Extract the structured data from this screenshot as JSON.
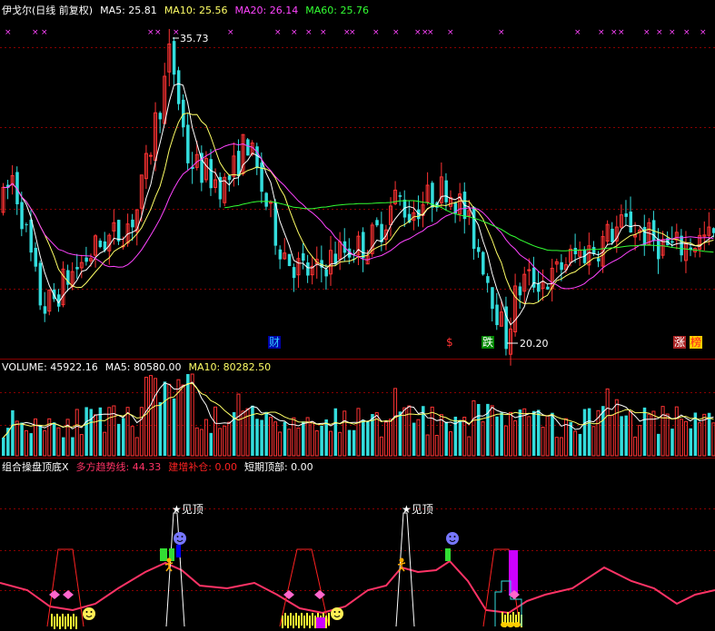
{
  "price_panel": {
    "header": [
      {
        "text": "伊戈尔(日线 前复权)",
        "color": "#ffffff"
      },
      {
        "text": "MA5: 25.81",
        "color": "#ffffff"
      },
      {
        "text": "MA10: 25.56",
        "color": "#ffff66"
      },
      {
        "text": "MA20: 26.14",
        "color": "#ff44ff"
      },
      {
        "text": "MA60: 25.76",
        "color": "#33ff33"
      }
    ],
    "high_label": "35.73",
    "low_label": "20.20",
    "markers": [
      {
        "text": "财",
        "fg": "#33ccff",
        "bg": "#0000aa"
      },
      {
        "text": "$",
        "fg": "#ff3333",
        "bg": "#000000"
      },
      {
        "text": "跌",
        "fg": "#ffffff",
        "bg": "#008800"
      },
      {
        "text": "涨",
        "fg": "#ffffff",
        "bg": "#aa2222"
      },
      {
        "text": "榜",
        "fg": "#ff2222",
        "bg": "#ffcc00"
      }
    ]
  },
  "volume_panel": {
    "header": [
      {
        "text": "VOLUME: 45922.16",
        "color": "#ffffff"
      },
      {
        "text": "MA5: 80580.00",
        "color": "#ffffff"
      },
      {
        "text": "MA10: 80282.50",
        "color": "#ffff66"
      }
    ]
  },
  "indicator_panel": {
    "header": [
      {
        "text": "组合操盘顶底X",
        "color": "#ffffff"
      },
      {
        "text": "多方趋势线: 44.33",
        "color": "#ff3366"
      },
      {
        "text": "建增补仓: 0.00",
        "color": "#ff2222"
      },
      {
        "text": "短期顶部: 0.00",
        "color": "#ffffff"
      }
    ],
    "top_signal_label": "见顶"
  },
  "colors": {
    "up": "#ff3333",
    "down": "#33dddd",
    "ma5": "#ffffff",
    "ma10": "#ffff66",
    "ma20": "#ff44ff",
    "ma60": "#33ff33",
    "grid": "#880000",
    "trend": "#ff3366"
  },
  "chart_data": {
    "type": "candlestick",
    "price_range": [
      19.5,
      37.0
    ],
    "high": 35.73,
    "low": 20.2,
    "indicator_value": 44.33
  }
}
